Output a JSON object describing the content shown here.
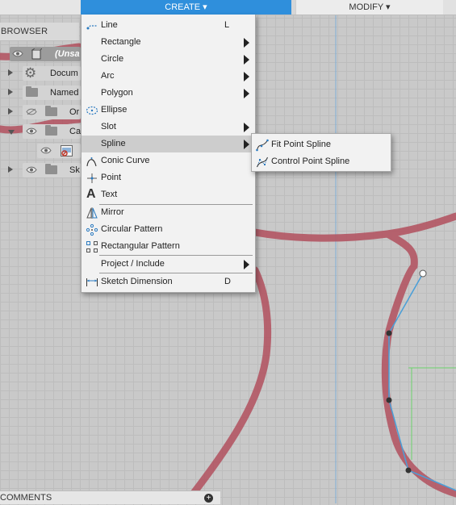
{
  "toolbar": {
    "create_label": "CREATE ▾",
    "modify_label": "MODIFY ▾"
  },
  "browser": {
    "header": "BROWSER",
    "items": [
      {
        "label": "(Unsa",
        "icon": "component-icon",
        "active": true
      },
      {
        "label": "Docum",
        "icon": "gear-icon"
      },
      {
        "label": "Named",
        "icon": "folder-icon"
      },
      {
        "label": "Or",
        "icon": "folder-icon",
        "eye_hidden": true
      },
      {
        "label": "Ca",
        "icon": "folder-icon"
      },
      {
        "label": "",
        "icon": "canvas-image-icon"
      },
      {
        "label": "Sk",
        "icon": "folder-icon"
      }
    ]
  },
  "create_menu": {
    "items": [
      {
        "label": "Line",
        "shortcut": "L",
        "icon": "line-icon"
      },
      {
        "label": "Rectangle",
        "submenu": true
      },
      {
        "label": "Circle",
        "submenu": true
      },
      {
        "label": "Arc",
        "submenu": true
      },
      {
        "label": "Polygon",
        "submenu": true
      },
      {
        "label": "Ellipse",
        "icon": "ellipse-icon"
      },
      {
        "label": "Slot",
        "submenu": true
      },
      {
        "label": "Spline",
        "submenu": true,
        "highlighted": true
      },
      {
        "label": "Conic Curve",
        "icon": "conic-curve-icon"
      },
      {
        "label": "Point",
        "icon": "point-icon"
      },
      {
        "label": "Text",
        "icon": "text-icon"
      },
      {
        "label": "Mirror",
        "icon": "mirror-icon"
      },
      {
        "label": "Circular Pattern",
        "icon": "circular-pattern-icon"
      },
      {
        "label": "Rectangular Pattern",
        "icon": "rectangular-pattern-icon"
      },
      {
        "label": "Project / Include",
        "submenu": true
      },
      {
        "label": "Sketch Dimension",
        "shortcut": "D",
        "icon": "sketch-dimension-icon"
      }
    ]
  },
  "spline_submenu": {
    "items": [
      {
        "label": "Fit Point Spline",
        "icon": "fit-point-spline-icon"
      },
      {
        "label": "Control Point Spline",
        "icon": "control-point-spline-icon"
      }
    ]
  },
  "comments": {
    "label": "COMMENTS",
    "add_symbol": "+"
  },
  "colors": {
    "accent": "#2f8fdc",
    "sketch_profile": "#b2505e",
    "spline_line": "#4a9fd8",
    "menu_highlight": "#cdcdcd"
  }
}
